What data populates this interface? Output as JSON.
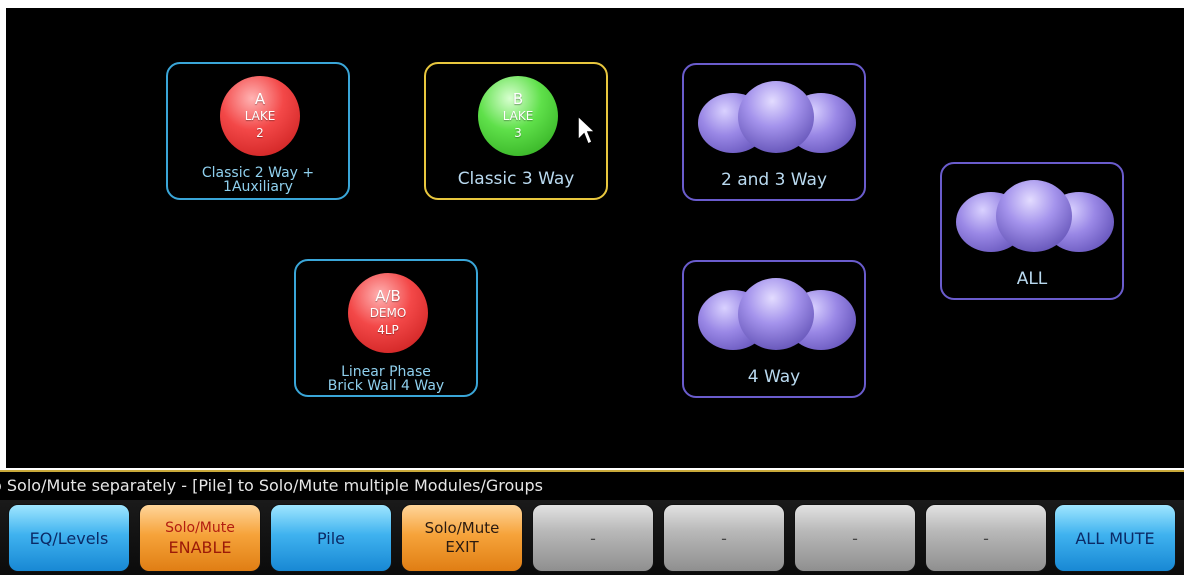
{
  "modules": [
    {
      "id": "a",
      "circle_lines": [
        "A",
        "LAKE",
        "2"
      ],
      "label_lines": [
        "Classic 2 Way +",
        "1Auxiliary"
      ],
      "color": "#f34848"
    },
    {
      "id": "b",
      "circle_lines": [
        "B",
        "LAKE",
        "3"
      ],
      "label_lines": [
        "Classic 3 Way"
      ],
      "color": "#5fe04a"
    },
    {
      "id": "ab",
      "circle_lines": [
        "A/B",
        "DEMO",
        "4LP"
      ],
      "label_lines": [
        "Linear Phase",
        "Brick Wall 4 Way"
      ],
      "color": "#f34848"
    }
  ],
  "groups": [
    {
      "id": "g23",
      "label": "2 and 3 Way"
    },
    {
      "id": "g4",
      "label": "4 Way"
    },
    {
      "id": "gall",
      "label": "ALL"
    }
  ],
  "status_text": "o Solo/Mute separately - [Pile] to Solo/Mute multiple Modules/Groups",
  "buttons": [
    {
      "label_lines": [
        "EQ/Levels"
      ]
    },
    {
      "label_lines": [
        "Solo/Mute",
        "ENABLE"
      ]
    },
    {
      "label_lines": [
        "Pile"
      ]
    },
    {
      "label_lines": [
        "Solo/Mute",
        "EXIT"
      ]
    },
    {
      "label_lines": [
        "-"
      ]
    },
    {
      "label_lines": [
        "-"
      ]
    },
    {
      "label_lines": [
        "-"
      ]
    },
    {
      "label_lines": [
        "-"
      ]
    },
    {
      "label_lines": [
        "ALL MUTE"
      ]
    }
  ],
  "colors": {
    "accent_blue": "#3aa6d8",
    "selected": "#e8c73e",
    "group": "#6a5ccd"
  }
}
